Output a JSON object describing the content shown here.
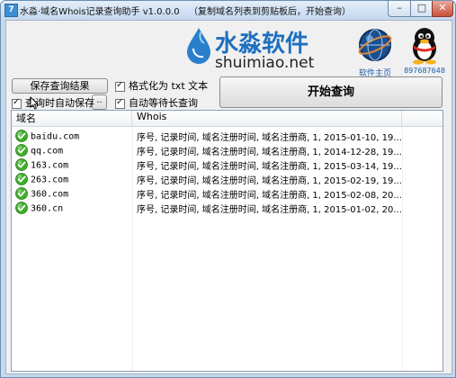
{
  "window": {
    "icon_glyph": "7",
    "title": "水淼·域名Whois记录查询助手 v1.0.0.0",
    "hint": "（复制域名列表到剪贴板后，开始查询）",
    "controls": {
      "minimize": "–",
      "maximize": "□",
      "close": "✕"
    }
  },
  "brand": {
    "name_cn": "水淼软件",
    "name_en": "shuimiao.net",
    "home_label": "软件主页",
    "qq_label": "897687648"
  },
  "toolbar": {
    "save_label": "保存查询结果",
    "browse_label": "..",
    "start_label": "开始查询",
    "autosave_label": "查询时自动保存",
    "autosave_checked": true,
    "txt_format_label": "格式化为 txt 文本",
    "txt_format_checked": true,
    "wait_label": "自动等待长查询",
    "wait_checked": true
  },
  "table": {
    "columns": [
      "域名",
      "Whois"
    ],
    "rows": [
      {
        "status": "ok",
        "domain": "baidu.com",
        "whois": "序号, 记录时间, 域名注册时间, 域名注册商, 1, 2015-01-10, 19..."
      },
      {
        "status": "ok",
        "domain": "qq.com",
        "whois": "序号, 记录时间, 域名注册时间, 域名注册商, 1, 2014-12-28, 19..."
      },
      {
        "status": "ok",
        "domain": "163.com",
        "whois": "序号, 记录时间, 域名注册时间, 域名注册商, 1, 2015-03-14, 19..."
      },
      {
        "status": "ok",
        "domain": "263.com",
        "whois": "序号, 记录时间, 域名注册时间, 域名注册商, 1, 2015-02-19, 19..."
      },
      {
        "status": "ok",
        "domain": "360.com",
        "whois": "序号, 记录时间, 域名注册时间, 域名注册商, 1, 2015-02-08, 20..."
      },
      {
        "status": "ok",
        "domain": "360.cn",
        "whois": "序号, 记录时间, 域名注册时间, 域名注册商, 1, 2015-01-02, 20..."
      }
    ]
  },
  "colors": {
    "accent": "#1f6fbe",
    "link": "#1a5faa",
    "ok_green": "#3fae2a"
  }
}
